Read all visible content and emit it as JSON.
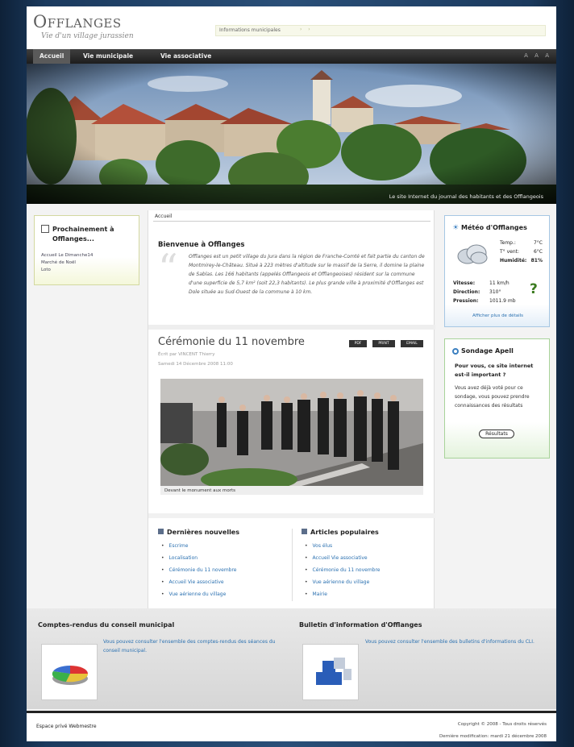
{
  "header": {
    "logo_title": "Offlanges",
    "logo_subtitle": "Vie d'un village jurassien",
    "search_label": "Informations municipales",
    "search_dots": "› ›"
  },
  "nav": {
    "items": [
      "Accueil",
      "Vie municipale",
      "Vie associative"
    ],
    "tools": "A A A"
  },
  "banner": {
    "caption": "Le site Internet du journal des habitants et des Offlangeois"
  },
  "agenda": {
    "title": "Prochainement à Offlanges...",
    "links": [
      "Accueil Le Dimanche14",
      "Marché de Noël",
      "Loto"
    ]
  },
  "main": {
    "breadcrumb": "Accueil",
    "welcome": {
      "title": "Bienvenue à Offlanges",
      "text": "Offlanges est un petit village du Jura dans la région de Franche-Comté et fait partie du canton de Montmirey-le-Château. Situé à 223 mètres d'altitude sur le massif de la Serre, il domine la plaine de Sablas. Les 166 habitants (appelés Offlangeois et Offlangeoises) résident sur la commune d'une superficie de 5,7 km² (soit 22,3 habitants). Le plus grande ville à proximité d'Offlanges est Dole située au Sud-Ouest de la commune à 10 km."
    },
    "article": {
      "title": "Cérémonie du 11 novembre",
      "buttons": [
        "PDF",
        "PRINT",
        "EMAIL"
      ],
      "author": "Écrit par VINCENT Thierry",
      "date": "Samedi 14 Décembre 2008 11:00",
      "photo_caption": "Devant le monument aux morts"
    },
    "latest": {
      "title": "Dernières nouvelles",
      "items": [
        "Escrime",
        "Localisation",
        "Cérémonie du 11 novembre",
        "Accueil Vie associative",
        "Vue aérienne du village"
      ]
    },
    "popular": {
      "title": "Articles populaires",
      "items": [
        "Vos élus",
        "Accueil Vie associative",
        "Cérémonie du 11 novembre",
        "Vue aérienne du village",
        "Mairie"
      ]
    }
  },
  "weather": {
    "title": "Météo d'Offlanges",
    "rows": [
      {
        "label": "Temp.:",
        "value": "7°C"
      },
      {
        "label": "T° vent:",
        "value": "6°C"
      },
      {
        "label": "Humidité:",
        "value": "81%"
      }
    ],
    "rows2": [
      {
        "label": "Vitesse:",
        "value": "11 km/h"
      },
      {
        "label": "Direction:",
        "value": "310°"
      },
      {
        "label": "Pression:",
        "value": "1011.9 mb"
      }
    ],
    "question_mark": "?",
    "link": "Afficher plus de détails"
  },
  "poll": {
    "title": "Sondage Apell",
    "question": "Pour vous, ce site internet est-il important ?",
    "text": "Vous avez déjà voté pour ce sondage, vous pouvez prendre connaissances des résultats",
    "button": "Résultats"
  },
  "bottom": {
    "council": {
      "title": "Comptes-rendus du conseil municipal",
      "text": "Vous pouvez consulter l'ensemble des comptes-rendus des séances du conseil municipal."
    },
    "bulletin": {
      "title": "Bulletin d'information d'Offlanges",
      "text": "Vous pouvez consulter l'ensemble des bulletins d'informations du CLI."
    }
  },
  "footer": {
    "links": "Espace privé     Webmestre",
    "copyright": "Copyright © 2008 - Tous droits réservés",
    "updated": "Dernière modification: mardi 21 décembre 2008"
  }
}
